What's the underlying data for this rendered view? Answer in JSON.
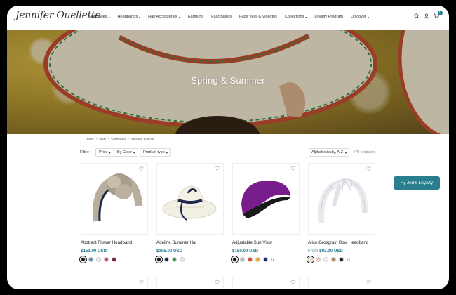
{
  "brand": {
    "logo_text": "Jennifer Ouellette"
  },
  "nav": {
    "items": [
      {
        "label": "Hat Styles",
        "dropdown": true
      },
      {
        "label": "Headbands",
        "dropdown": true
      },
      {
        "label": "Hair Accessories",
        "dropdown": true
      },
      {
        "label": "Earmuffs",
        "dropdown": false
      },
      {
        "label": "Fascinators",
        "dropdown": false
      },
      {
        "label": "Face Veils & Violettes",
        "dropdown": false
      },
      {
        "label": "Collections",
        "dropdown": true
      },
      {
        "label": "Loyalty Program",
        "dropdown": false
      },
      {
        "label": "Discover",
        "dropdown": true
      }
    ],
    "cart_count": "0"
  },
  "hero": {
    "title": "Spring & Summer"
  },
  "breadcrumb": [
    "Home",
    "Shop",
    "Collections",
    "Spring & Summer"
  ],
  "filters": {
    "label": "Filter:",
    "price": "Price",
    "color": "By Color",
    "product_type": "Product type",
    "sort": "Alphabetically, A-Z",
    "count": "479 products"
  },
  "products": [
    {
      "name": "Abstract Flower Headband",
      "price": "$151.00 USD",
      "from": "",
      "swatches": [
        "#1e1e1e",
        "#6a8bb0",
        "#f0ebe0",
        "#e04a6a",
        "#7a1f3a"
      ],
      "more": ""
    },
    {
      "name": "Adeline Summer Hat",
      "price": "$385.00 USD",
      "from": "",
      "swatches": [
        "#1a1a1a",
        "#1b2a5a",
        "#2ea84a",
        "#e8e6d8"
      ],
      "more": ""
    },
    {
      "name": "Adjustable Sun Visor",
      "price": "$150.00 USD",
      "from": "",
      "swatches": [
        "#1a1a1a",
        "#bdbdbd",
        "#e0462a",
        "#f0a53a",
        "#1b2a6a"
      ],
      "more": "+2"
    },
    {
      "name": "Alice Grosgrain Bow Headband",
      "price": "$92.00 USD",
      "from": "From",
      "swatches": [
        "#efe6d2",
        "#f3c9c0",
        "#f2f2f2",
        "#a88a6a",
        "#222222"
      ],
      "more": "+1"
    }
  ],
  "loyalty": {
    "label": "Jen's Loyalty"
  }
}
